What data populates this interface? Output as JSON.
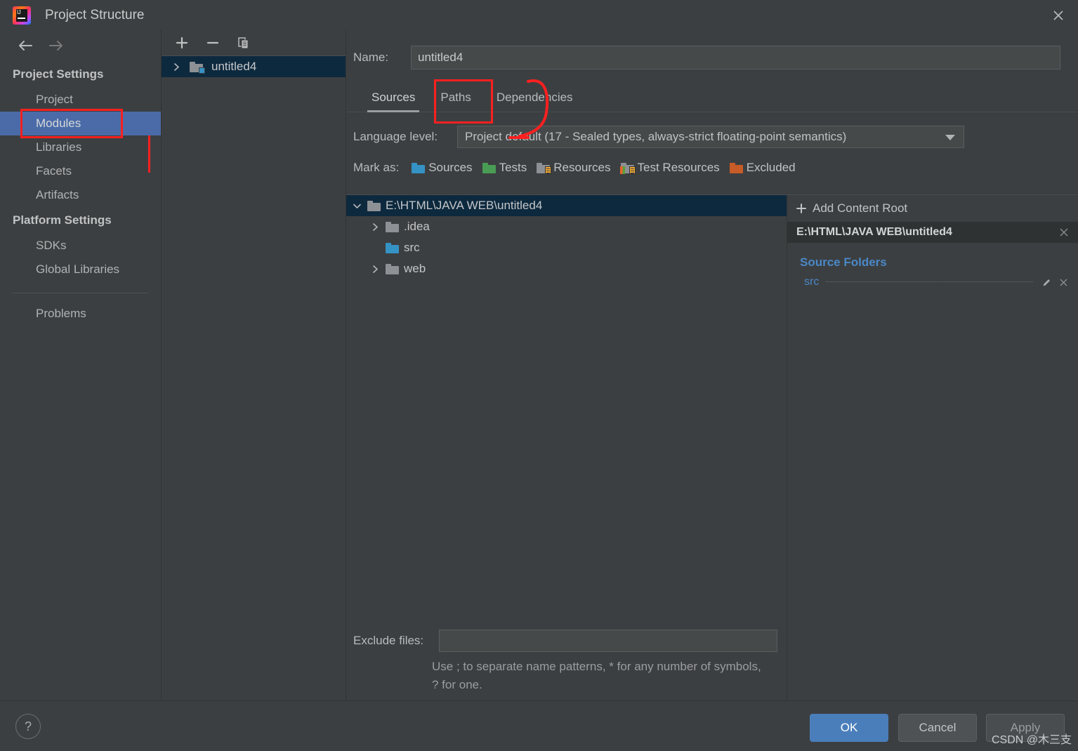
{
  "window": {
    "title": "Project Structure",
    "logo_icon": "intellij-idea-logo",
    "close_icon": "close-icon"
  },
  "sidebar": {
    "back_icon": "arrow-left-icon",
    "forward_icon": "arrow-right-icon",
    "groups": [
      {
        "header": "Project Settings",
        "items": [
          {
            "label": "Project",
            "selected": false
          },
          {
            "label": "Modules",
            "selected": true
          },
          {
            "label": "Libraries",
            "selected": false
          },
          {
            "label": "Facets",
            "selected": false
          },
          {
            "label": "Artifacts",
            "selected": false
          }
        ]
      },
      {
        "header": "Platform Settings",
        "items": [
          {
            "label": "SDKs",
            "selected": false
          },
          {
            "label": "Global Libraries",
            "selected": false
          }
        ]
      }
    ],
    "problems_label": "Problems",
    "selected_color": "#4a6ba8"
  },
  "modules_panel": {
    "toolbar": {
      "add_icon": "plus-icon",
      "remove_icon": "minus-icon",
      "copy_icon": "copy-icon"
    },
    "items": [
      {
        "label": "untitled4",
        "icon": "module-folder-icon",
        "selected": true,
        "expand_icon": "chevron-right-icon"
      }
    ]
  },
  "main": {
    "name_label": "Name:",
    "name_value": "untitled4",
    "name_placeholder": "",
    "tabs": [
      {
        "label": "Sources",
        "active": true
      },
      {
        "label": "Paths",
        "active": false
      },
      {
        "label": "Dependencies",
        "active": false
      }
    ],
    "language_level_label": "Language level:",
    "language_level_value": "Project default (17 - Sealed types, always-strict floating-point semantics)",
    "dropdown_icon": "chevron-down-icon",
    "mark_as_label": "Mark as:",
    "mark_as_options": [
      {
        "label": "Sources",
        "accel": "S",
        "color": "#3592c4",
        "icon": "folder-sources-icon"
      },
      {
        "label": "Tests",
        "accel": "T",
        "color": "#499c54",
        "icon": "folder-tests-icon"
      },
      {
        "label": "Resources",
        "accel": "",
        "color": "#8d9195",
        "icon": "folder-resources-icon"
      },
      {
        "label": "Test Resources",
        "accel": "",
        "color": "#8d9195",
        "icon": "folder-test-resources-icon"
      },
      {
        "label": "Excluded",
        "accel": "E",
        "color": "#c75c28",
        "icon": "folder-excluded-icon"
      }
    ],
    "tree": [
      {
        "label": "E:\\HTML\\JAVA WEB\\untitled4",
        "depth": 0,
        "expand_icon": "chevron-down-icon",
        "folder_color": "#8d9195",
        "selected": true
      },
      {
        "label": ".idea",
        "depth": 1,
        "expand_icon": "chevron-right-icon",
        "folder_color": "#8d9195",
        "selected": false
      },
      {
        "label": "src",
        "depth": 1,
        "expand_icon": "",
        "folder_color": "#3592c4",
        "selected": false
      },
      {
        "label": "web",
        "depth": 1,
        "expand_icon": "chevron-right-icon",
        "folder_color": "#8d9195",
        "selected": false
      }
    ],
    "exclude_label": "Exclude files:",
    "exclude_value": "",
    "exclude_hint": "Use ; to separate name patterns, * for any number of symbols, ? for one."
  },
  "content_root": {
    "add_label": "Add Content Root",
    "add_icon": "plus-icon",
    "add_accel": "C",
    "root_path": "E:\\HTML\\JAVA WEB\\untitled4",
    "root_remove_icon": "close-icon",
    "source_folders_title": "Source Folders",
    "source_folders": [
      {
        "name": "src",
        "edit_icon": "pencil-icon",
        "remove_icon": "close-icon"
      }
    ],
    "link_color": "#4a88c7"
  },
  "footer": {
    "help_label": "?",
    "ok_label": "OK",
    "cancel_label": "Cancel",
    "apply_label": "Apply",
    "watermark": "CSDN @木三支"
  },
  "annotations": {
    "color": "#fb2020",
    "highlight_modules": "Modules",
    "highlight_paths": "Paths",
    "arrow_target": "Project default"
  }
}
